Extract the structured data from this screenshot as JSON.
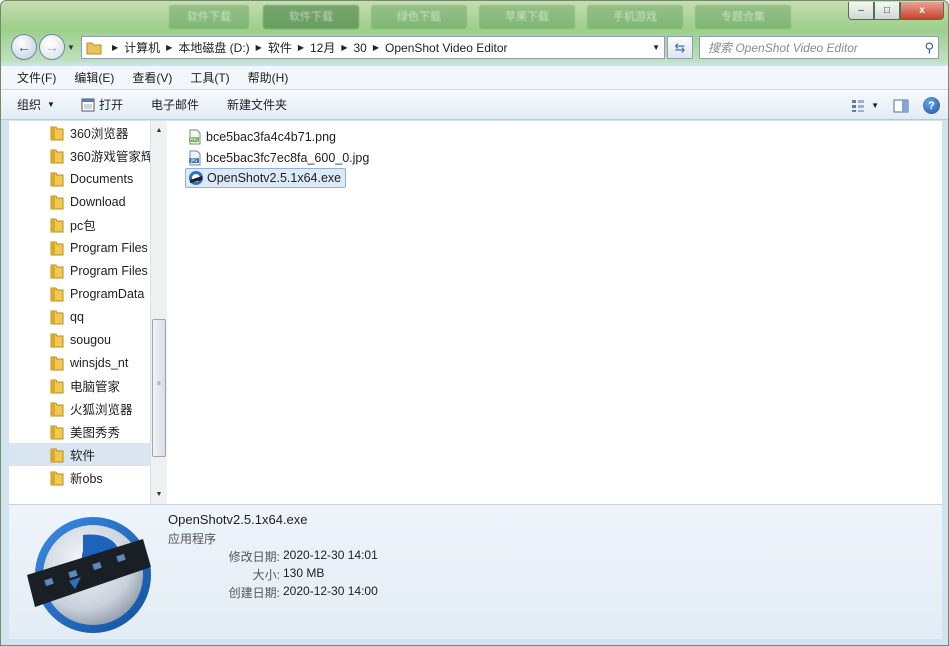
{
  "window": {
    "blurred_tabs": [
      "软件下载",
      "软件下载",
      "绿色下载",
      "苹果下载",
      "手机游戏",
      "专题合集"
    ]
  },
  "controls": {
    "minimize": "–",
    "maximize": "□",
    "close": "x"
  },
  "navigation": {
    "back_icon": "back-arrow-icon",
    "forward_icon": "forward-arrow-icon",
    "breadcrumb": [
      "计算机",
      "本地磁盘 (D:)",
      "软件",
      "12月",
      "30",
      "OpenShot Video Editor"
    ],
    "search_placeholder": "搜索 OpenShot Video Editor"
  },
  "menubar": {
    "items": [
      "文件(F)",
      "编辑(E)",
      "查看(V)",
      "工具(T)",
      "帮助(H)"
    ]
  },
  "commandbar": {
    "organize": "组织",
    "open": "打开",
    "email": "电子邮件",
    "new_folder": "新建文件夹"
  },
  "navpane": {
    "items": [
      {
        "label": "360浏览器",
        "selected": false
      },
      {
        "label": "360游戏管家辉",
        "selected": false
      },
      {
        "label": "Documents",
        "selected": false
      },
      {
        "label": "Download",
        "selected": false
      },
      {
        "label": "pc包",
        "selected": false
      },
      {
        "label": "Program Files",
        "selected": false
      },
      {
        "label": "Program Files",
        "selected": false
      },
      {
        "label": "ProgramData",
        "selected": false
      },
      {
        "label": "qq",
        "selected": false
      },
      {
        "label": "sougou",
        "selected": false
      },
      {
        "label": "winsjds_nt",
        "selected": false
      },
      {
        "label": "电脑管家",
        "selected": false
      },
      {
        "label": "火狐浏览器",
        "selected": false
      },
      {
        "label": "美图秀秀",
        "selected": false
      },
      {
        "label": "软件",
        "selected": true
      },
      {
        "label": "新obs",
        "selected": false
      }
    ]
  },
  "files": [
    {
      "name": "bce5bac3fa4c4b71.png",
      "icon": "png-file-icon",
      "selected": false
    },
    {
      "name": "bce5bac3fc7ec8fa_600_0.jpg",
      "icon": "jpg-file-icon",
      "selected": false
    },
    {
      "name": "OpenShotv2.5.1x64.exe",
      "icon": "openshot-app-icon",
      "selected": true
    }
  ],
  "details": {
    "name": "OpenShotv2.5.1x64.exe",
    "type": "应用程序",
    "modified_label": "修改日期:",
    "modified_value": "2020-12-30 14:01",
    "size_label": "大小:",
    "size_value": "130 MB",
    "created_label": "创建日期:",
    "created_value": "2020-12-30 14:00"
  },
  "colors": {
    "selection": "#d9e5f1",
    "accent": "#2d6fbf",
    "openshot_blue": "#1f6dc4"
  }
}
